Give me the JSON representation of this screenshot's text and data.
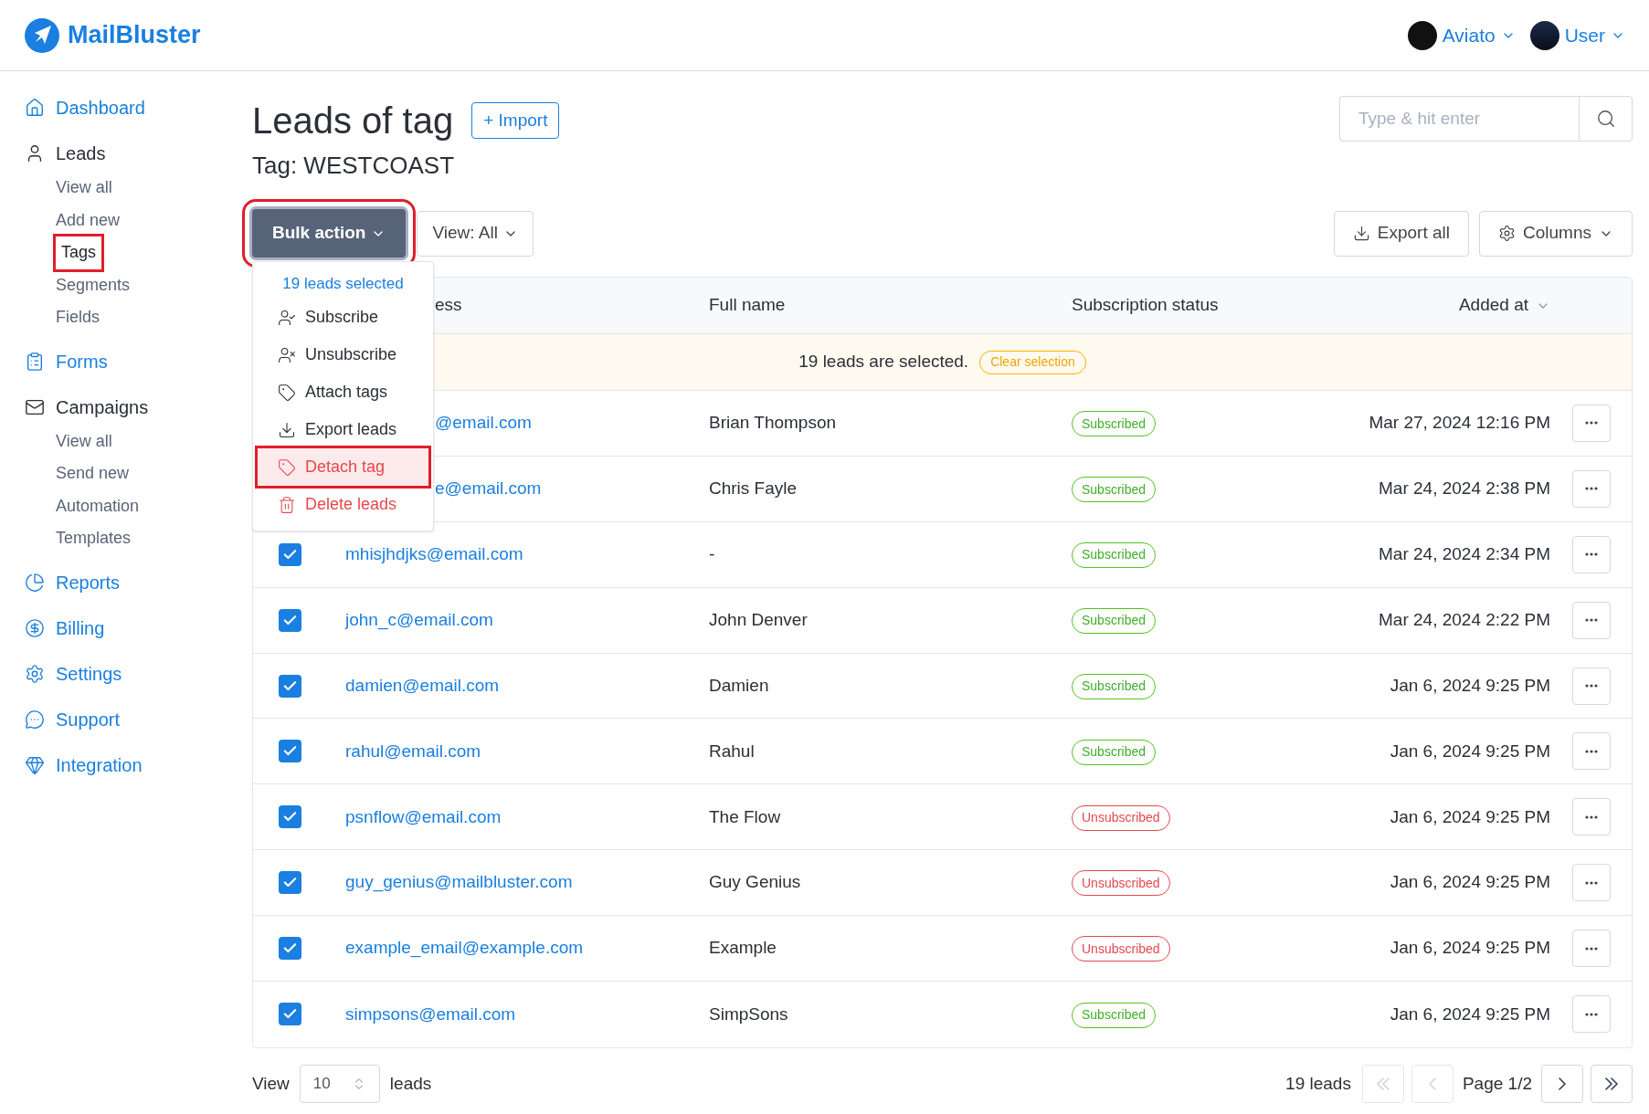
{
  "header": {
    "logo": "MailBluster",
    "accounts": [
      {
        "label": "Aviato"
      },
      {
        "label": "User"
      }
    ]
  },
  "sidebar": {
    "items": [
      {
        "label": "Dashboard",
        "selected": false,
        "expanded": false
      },
      {
        "label": "Leads",
        "selected": false,
        "expanded": true,
        "children": [
          {
            "label": "View all",
            "selected": false
          },
          {
            "label": "Add new",
            "selected": false
          },
          {
            "label": "Tags",
            "selected": true
          },
          {
            "label": "Segments",
            "selected": false
          },
          {
            "label": "Fields",
            "selected": false
          }
        ]
      },
      {
        "label": "Forms",
        "selected": false,
        "expanded": false
      },
      {
        "label": "Campaigns",
        "selected": false,
        "expanded": true,
        "children": [
          {
            "label": "View all",
            "selected": false
          },
          {
            "label": "Send new",
            "selected": false
          },
          {
            "label": "Automation",
            "selected": false
          },
          {
            "label": "Templates",
            "selected": false
          }
        ]
      },
      {
        "label": "Reports",
        "selected": false,
        "expanded": false
      },
      {
        "label": "Billing",
        "selected": false,
        "expanded": false
      },
      {
        "label": "Settings",
        "selected": false,
        "expanded": false
      },
      {
        "label": "Support",
        "selected": false,
        "expanded": false
      },
      {
        "label": "Integration",
        "selected": false,
        "expanded": false
      }
    ]
  },
  "page": {
    "title": "Leads of tag",
    "import_button": "+ Import",
    "subtitle": "Tag: WESTCOAST",
    "search": {
      "placeholder": "Type & hit enter"
    }
  },
  "toolbar": {
    "bulk_action": {
      "label": "Bulk action",
      "open": true
    },
    "view_filter": "View: All",
    "export_button": "Export all",
    "columns_button": "Columns"
  },
  "bulk_menu": {
    "header": "19 leads selected",
    "items": [
      {
        "label": "Subscribe",
        "kind": "normal",
        "selected": false
      },
      {
        "label": "Unsubscribe",
        "kind": "normal",
        "selected": false
      },
      {
        "label": "Attach tags",
        "kind": "normal",
        "selected": false
      },
      {
        "label": "Export leads",
        "kind": "normal",
        "selected": false
      },
      {
        "label": "Detach tag",
        "kind": "danger",
        "selected": true
      },
      {
        "label": "Delete leads",
        "kind": "danger",
        "selected": false
      }
    ]
  },
  "table": {
    "columns": [
      {
        "label": "ess"
      },
      {
        "label": "Full name"
      },
      {
        "label": "Subscription status"
      },
      {
        "label": "Added at"
      }
    ],
    "selection_banner": {
      "text": "19 leads are selected.",
      "clear_button": "Clear selection"
    },
    "rows": [
      {
        "email": "@email.com",
        "name": "Brian Thompson",
        "status": {
          "label": "Subscribed",
          "kind": "subscribed"
        },
        "added": "Mar 27, 2024 12:16 PM"
      },
      {
        "email": "e@email.com",
        "name": "Chris Fayle",
        "status": {
          "label": "Subscribed",
          "kind": "subscribed"
        },
        "added": "Mar 24, 2024 2:38 PM"
      },
      {
        "checked": true,
        "email": "mhisjhdjks@email.com",
        "name": "-",
        "status": {
          "label": "Subscribed",
          "kind": "subscribed"
        },
        "added": "Mar 24, 2024 2:34 PM"
      },
      {
        "checked": true,
        "email": "john_c@email.com",
        "name": "John Denver",
        "status": {
          "label": "Subscribed",
          "kind": "subscribed"
        },
        "added": "Mar 24, 2024 2:22 PM"
      },
      {
        "checked": true,
        "email": "damien@email.com",
        "name": "Damien",
        "status": {
          "label": "Subscribed",
          "kind": "subscribed"
        },
        "added": "Jan 6, 2024 9:25 PM"
      },
      {
        "checked": true,
        "email": "rahul@email.com",
        "name": "Rahul",
        "status": {
          "label": "Subscribed",
          "kind": "subscribed"
        },
        "added": "Jan 6, 2024 9:25 PM"
      },
      {
        "checked": true,
        "email": "psnflow@email.com",
        "name": "The Flow",
        "status": {
          "label": "Unsubscribed",
          "kind": "unsubscribed"
        },
        "added": "Jan 6, 2024 9:25 PM"
      },
      {
        "checked": true,
        "email": "guy_genius@mailbluster.com",
        "name": "Guy Genius",
        "status": {
          "label": "Unsubscribed",
          "kind": "unsubscribed"
        },
        "added": "Jan 6, 2024 9:25 PM"
      },
      {
        "checked": true,
        "email": "example_email@example.com",
        "name": "Example",
        "status": {
          "label": "Unsubscribed",
          "kind": "unsubscribed"
        },
        "added": "Jan 6, 2024 9:25 PM"
      },
      {
        "checked": true,
        "email": "simpsons@email.com",
        "name": "SimpSons",
        "status": {
          "label": "Subscribed",
          "kind": "subscribed"
        },
        "added": "Jan 6, 2024 9:25 PM"
      }
    ]
  },
  "footer": {
    "view_label": "View",
    "page_size": "10",
    "leads_label": "leads",
    "total": "19 leads",
    "page": "Page 1/2",
    "first_disabled": true,
    "prev_disabled": true,
    "next_disabled": false,
    "last_disabled": false
  }
}
